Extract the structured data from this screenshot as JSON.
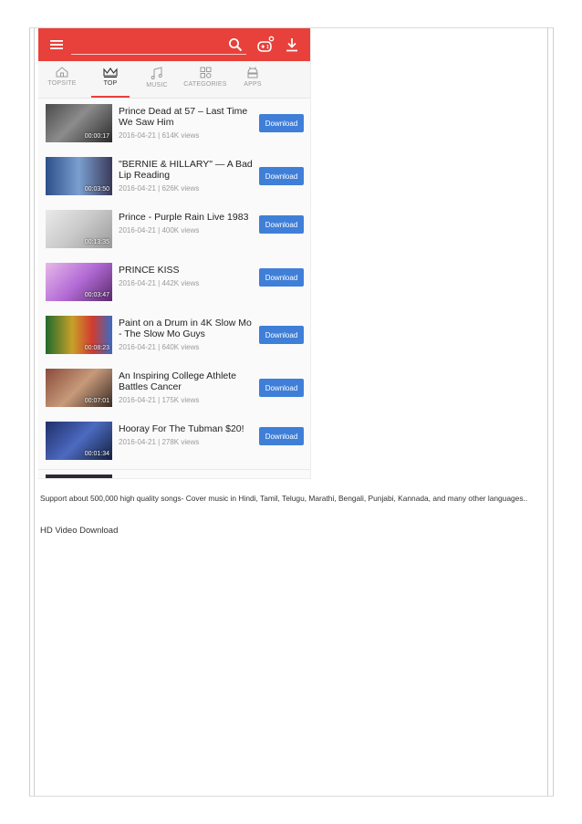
{
  "theme": {
    "accent": "#e8403a",
    "button": "#3f7fd8"
  },
  "toolbar": {
    "menu_icon": "hamburger-icon",
    "search_icon": "search-icon",
    "game_icon": "game-controller-icon",
    "download_icon": "download-icon"
  },
  "tabs": [
    {
      "label": "TOPSITE",
      "icon": "home-icon"
    },
    {
      "label": "TOP",
      "icon": "crown-icon",
      "active": true
    },
    {
      "label": "MUSIC",
      "icon": "music-note-icon"
    },
    {
      "label": "CATEGORIES",
      "icon": "grid-icon"
    },
    {
      "label": "APPS",
      "icon": "android-icon"
    }
  ],
  "videos": [
    {
      "title": "Prince Dead at 57 – Last Time We Saw Him",
      "meta": "2016-04-21 | 614K views",
      "duration": "00:00:17",
      "button": "Download"
    },
    {
      "title": "\"BERNIE & HILLARY\" — A Bad Lip Reading",
      "meta": "2016-04-21 | 626K views",
      "duration": "00:03:50",
      "button": "Download"
    },
    {
      "title": "Prince - Purple Rain Live 1983",
      "meta": "2016-04-21 | 400K views",
      "duration": "00:13:35",
      "button": "Download"
    },
    {
      "title": "PRINCE KISS",
      "meta": "2016-04-21 | 442K views",
      "duration": "00:03:47",
      "button": "Download"
    },
    {
      "title": "Paint on a Drum in 4K Slow Mo - The Slow Mo Guys",
      "meta": "2016-04-21 | 640K views",
      "duration": "00:08:23",
      "button": "Download"
    },
    {
      "title": "An Inspiring College Athlete Battles Cancer",
      "meta": "2016-04-21 | 175K views",
      "duration": "00:07:01",
      "button": "Download"
    },
    {
      "title": "Hooray For The Tubman $20!",
      "meta": "2016-04-21 | 278K views",
      "duration": "00:01:34",
      "button": "Download"
    }
  ],
  "caption": "Support about 500,000 high quality songs- Cover music in Hindi, Tamil, Telugu, Marathi, Bengali, Punjabi, Kannada, and many other languages..",
  "subheading": "HD Video Download"
}
